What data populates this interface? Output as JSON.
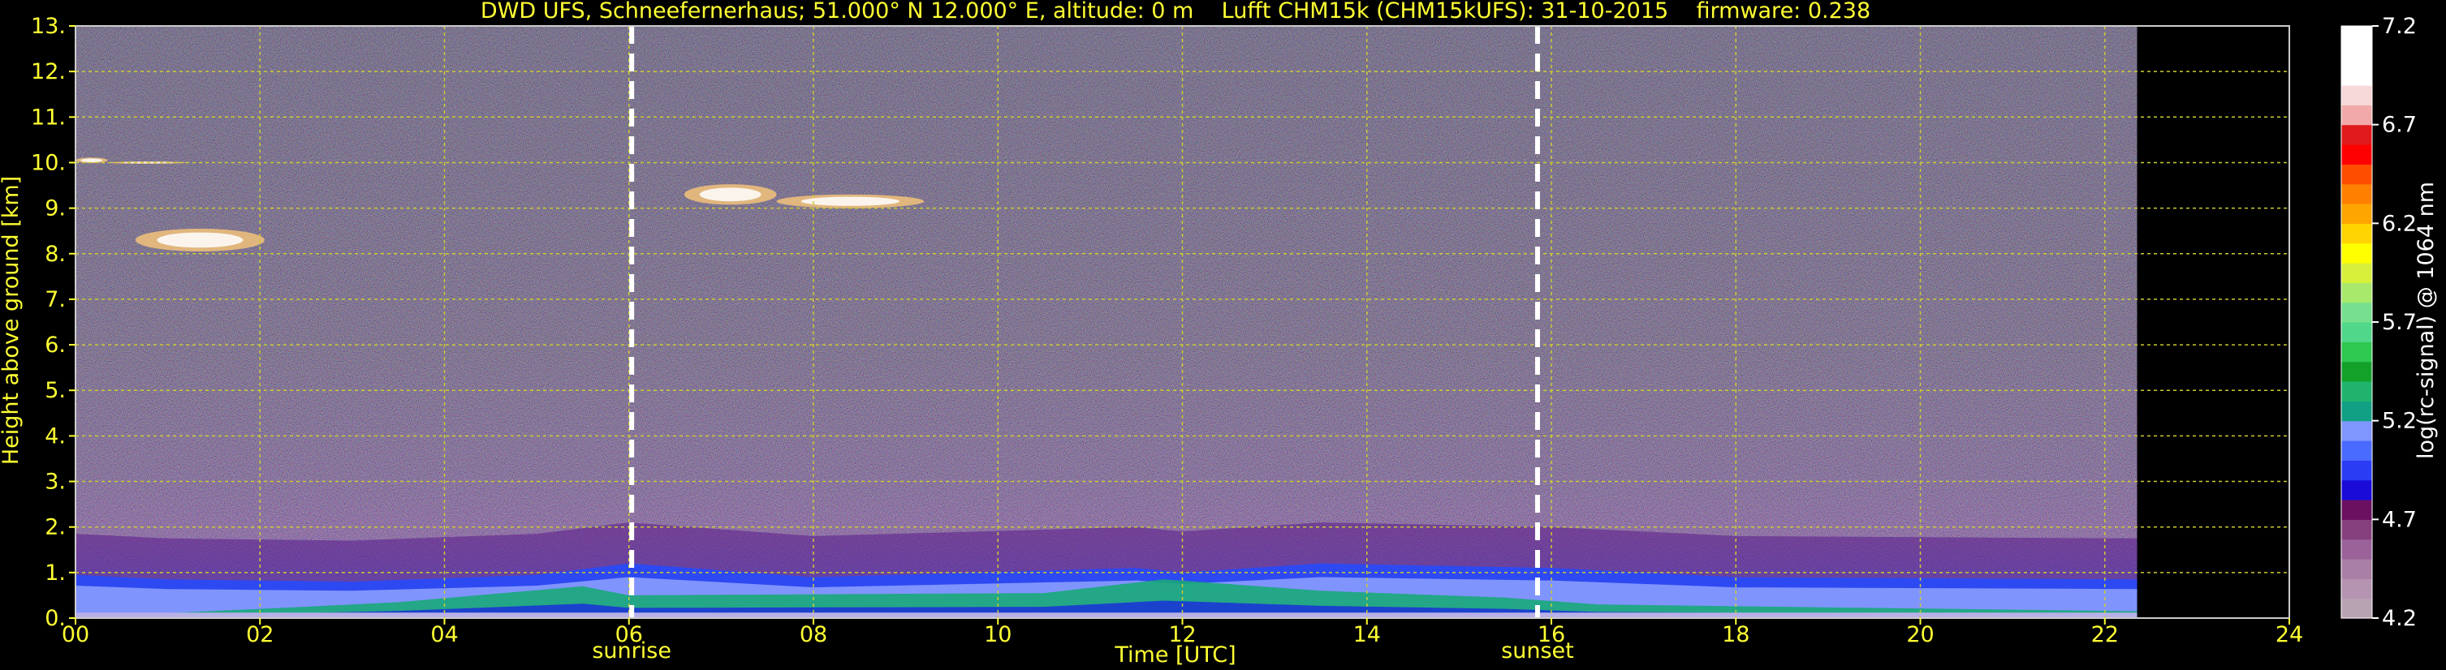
{
  "chart_data": {
    "type": "heatmap",
    "title": "DWD UFS, Schneefernerhaus; 51.000° N 12.000° E, altitude: 0 m    Lufft CHM15k (CHM15kUFS): 31-10-2015    firmware: 0.238",
    "xlabel": "Time [UTC]",
    "ylabel": "Height above ground [km]",
    "xlim": [
      0,
      24
    ],
    "ylim": [
      0,
      13
    ],
    "x_ticks": [
      "00",
      "02",
      "04",
      "06",
      "08",
      "10",
      "12",
      "14",
      "16",
      "18",
      "20",
      "22",
      "24"
    ],
    "x_tick_values": [
      0,
      2,
      4,
      6,
      8,
      10,
      12,
      14,
      16,
      18,
      20,
      22,
      24
    ],
    "y_ticks": [
      "0.",
      "1.",
      "2.",
      "3.",
      "4.",
      "5.",
      "6.",
      "7.",
      "8.",
      "9.",
      "10.",
      "11.",
      "12.",
      "13."
    ],
    "y_tick_values": [
      0,
      1,
      2,
      3,
      4,
      5,
      6,
      7,
      8,
      9,
      10,
      11,
      12,
      13
    ],
    "grid": true,
    "data_end_hour": 22.35,
    "markers": [
      {
        "label": "sunrise",
        "hour": 6.03
      },
      {
        "label": "sunset",
        "hour": 15.85
      }
    ],
    "boundary_layer": [
      {
        "hour": 0.0,
        "top_km": 0.95
      },
      {
        "hour": 1.0,
        "top_km": 0.85
      },
      {
        "hour": 3.0,
        "top_km": 0.8
      },
      {
        "hour": 5.0,
        "top_km": 0.95
      },
      {
        "hour": 6.0,
        "top_km": 1.2
      },
      {
        "hour": 8.0,
        "top_km": 0.9
      },
      {
        "hour": 11.5,
        "top_km": 1.1
      },
      {
        "hour": 12.0,
        "top_km": 1.0
      },
      {
        "hour": 13.5,
        "top_km": 1.2
      },
      {
        "hour": 16.0,
        "top_km": 1.1
      },
      {
        "hour": 18.0,
        "top_km": 0.9
      },
      {
        "hour": 22.35,
        "top_km": 0.85
      }
    ],
    "aerosol_layer": [
      {
        "hour": 0.9,
        "top_km": 0.1
      },
      {
        "hour": 2.5,
        "top_km": 0.25
      },
      {
        "hour": 3.5,
        "top_km": 0.35
      },
      {
        "hour": 5.5,
        "top_km": 0.7
      },
      {
        "hour": 6.0,
        "top_km": 0.5
      },
      {
        "hour": 10.5,
        "top_km": 0.55
      },
      {
        "hour": 11.8,
        "top_km": 0.85
      },
      {
        "hour": 13.5,
        "top_km": 0.6
      },
      {
        "hour": 15.5,
        "top_km": 0.45
      },
      {
        "hour": 16.5,
        "top_km": 0.3
      },
      {
        "hour": 22.35,
        "top_km": 0.15
      }
    ],
    "clouds": [
      {
        "hour_start": 0.0,
        "hour_end": 0.35,
        "height_km": 10.05,
        "thickness_km": 0.12
      },
      {
        "hour_start": 0.35,
        "hour_end": 1.2,
        "height_km": 10.0,
        "thickness_km": 0.05
      },
      {
        "hour_start": 0.65,
        "hour_end": 2.05,
        "height_km": 8.3,
        "thickness_km": 0.5
      },
      {
        "hour_start": 6.6,
        "hour_end": 7.6,
        "height_km": 9.3,
        "thickness_km": 0.45
      },
      {
        "hour_start": 7.6,
        "hour_end": 9.2,
        "height_km": 9.15,
        "thickness_km": 0.3
      }
    ],
    "colorbar": {
      "label": "log(rc-signal) @ 1064 nm",
      "range": [
        4.2,
        7.2
      ],
      "ticks": [
        "7.2",
        "6.7",
        "6.2",
        "5.7",
        "5.2",
        "4.7",
        "4.2"
      ],
      "tick_values": [
        7.2,
        6.7,
        6.2,
        5.7,
        5.2,
        4.7,
        4.2
      ],
      "colors": [
        "#b8a3b3",
        "#b494b0",
        "#a97fa5",
        "#9a6299",
        "#85407d",
        "#6b1060",
        "#1a0bd8",
        "#2a3df5",
        "#4a6bff",
        "#7f96ff",
        "#12a084",
        "#1fb36e",
        "#13a12a",
        "#2ec750",
        "#50d78a",
        "#76e08e",
        "#a8e86a",
        "#d7f03a",
        "#ffff00",
        "#ffd400",
        "#ffa500",
        "#ff8000",
        "#ff4d00",
        "#ff0000",
        "#e01a1a",
        "#f2a9a9",
        "#f7d8d8",
        "#ffffff",
        "#ffffff",
        "#ffffff"
      ]
    }
  },
  "colors": {
    "text": "#ffff33",
    "grid": "#cccc33",
    "background": "#000000",
    "marker_line": "#ffffff"
  }
}
